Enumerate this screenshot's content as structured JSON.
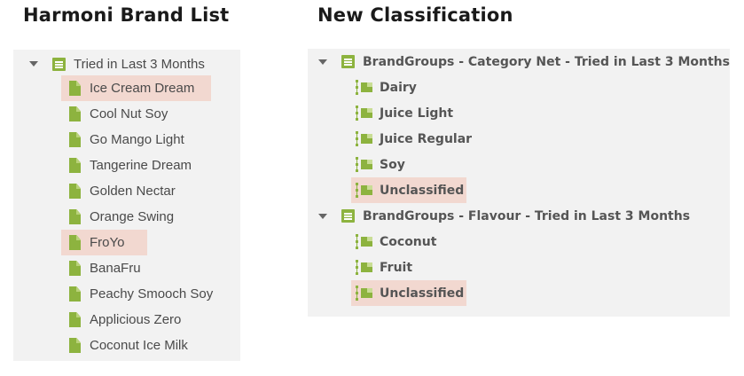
{
  "left_panel": {
    "heading": "Harmoni Brand List",
    "root_label": "Tried in Last 3 Months",
    "items": [
      {
        "label": "Ice Cream Dream",
        "highlighted": true
      },
      {
        "label": "Cool Nut Soy",
        "highlighted": false
      },
      {
        "label": "Go Mango Light",
        "highlighted": false
      },
      {
        "label": "Tangerine Dream",
        "highlighted": false
      },
      {
        "label": "Golden Nectar",
        "highlighted": false
      },
      {
        "label": "Orange Swing",
        "highlighted": false
      },
      {
        "label": "FroYo",
        "highlighted": true
      },
      {
        "label": "BanaFru",
        "highlighted": false
      },
      {
        "label": "Peachy Smooch Soy",
        "highlighted": false
      },
      {
        "label": "Applicious Zero",
        "highlighted": false
      },
      {
        "label": "Coconut Ice Milk",
        "highlighted": false
      }
    ]
  },
  "right_panel": {
    "heading": "New Classification",
    "groups": [
      {
        "label": "BrandGroups - Category Net - Tried in Last 3 Months",
        "items": [
          {
            "label": "Dairy",
            "highlighted": false
          },
          {
            "label": "Juice Light",
            "highlighted": false
          },
          {
            "label": "Juice Regular",
            "highlighted": false
          },
          {
            "label": "Soy",
            "highlighted": false
          },
          {
            "label": "Unclassified",
            "highlighted": true
          }
        ]
      },
      {
        "label": "BrandGroups - Flavour - Tried in Last 3 Months",
        "items": [
          {
            "label": "Coconut",
            "highlighted": false
          },
          {
            "label": "Fruit",
            "highlighted": false
          },
          {
            "label": "Unclassified",
            "highlighted": true
          }
        ]
      }
    ]
  },
  "colors": {
    "icon_green": "#8db33f",
    "highlight": "#f2d8d0",
    "panel_bg": "#f2f2f2"
  },
  "icons": {
    "root_left": "list-icon",
    "item_left": "document-icon",
    "root_right": "list-icon",
    "item_right": "group-icon",
    "expander": "caret-down-icon"
  }
}
